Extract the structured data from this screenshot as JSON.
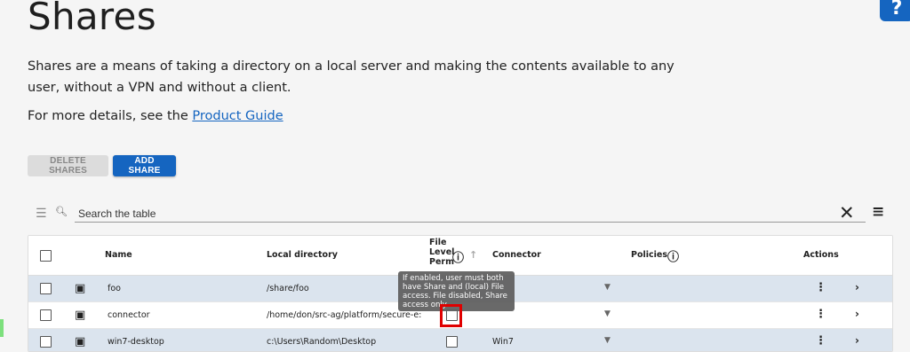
{
  "page": {
    "title": "Shares",
    "description": "Shares are a means of taking a directory on a local server and making the contents available to any user, without a VPN and without a client.",
    "more_prefix": "For more details, see the ",
    "more_link": "Product Guide",
    "help_label": "?"
  },
  "toolbar": {
    "delete_label": "DELETE SHARES",
    "add_label": "ADD SHARE"
  },
  "search": {
    "placeholder": "Search the table"
  },
  "table": {
    "columns": {
      "name": "Name",
      "local_directory": "Local directory",
      "file_level_perm": "File Level Perm",
      "connector": "Connector",
      "policies": "Policies",
      "actions": "Actions"
    },
    "rows": [
      {
        "name": "foo",
        "local_directory": "/share/foo",
        "connector": ""
      },
      {
        "name": "connector",
        "local_directory": "/home/don/src-ag/platform/secure-e:",
        "connector": ""
      },
      {
        "name": "win7-desktop",
        "local_directory": "c:\\Users\\Random\\Desktop",
        "connector": "Win7"
      }
    ]
  },
  "tooltip": {
    "text": "If enabled, user must both have Share and (local) File access. File disabled, Share access only"
  },
  "colors": {
    "accent": "#1565c0",
    "row_highlight": "#dbe4ee",
    "annotation": "#e00000"
  }
}
